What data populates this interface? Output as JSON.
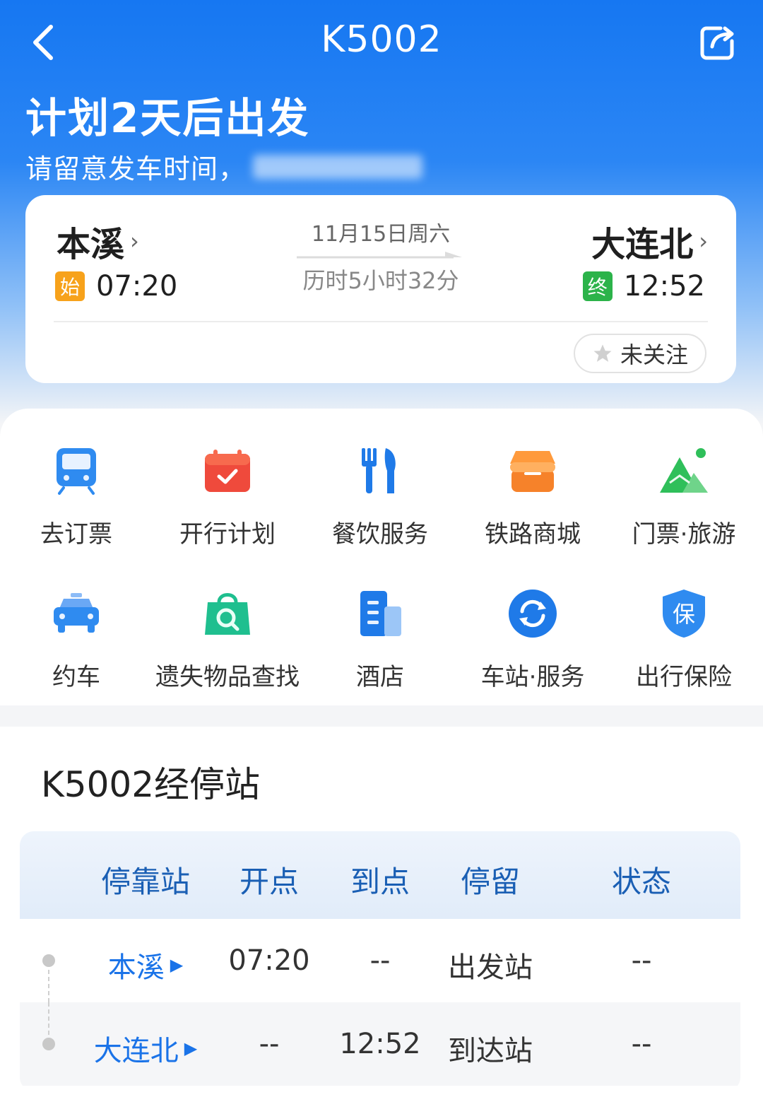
{
  "header": {
    "title": "K5002",
    "plan_title": "计划2天后出发",
    "plan_subtitle": "请留意发车时间，"
  },
  "trip": {
    "from_station": "本溪",
    "to_station": "大连北",
    "from_badge": "始",
    "to_badge": "终",
    "depart_time": "07:20",
    "arrive_time": "12:52",
    "date": "11月15日周六",
    "duration": "历时5小时32分",
    "follow_label": "未关注",
    "chevron": "›"
  },
  "services": [
    {
      "label": "去订票",
      "icon": "train-icon"
    },
    {
      "label": "开行计划",
      "icon": "calendar-icon"
    },
    {
      "label": "餐饮服务",
      "icon": "dining-icon"
    },
    {
      "label": "铁路商城",
      "icon": "store-icon"
    },
    {
      "label": "门票·旅游",
      "icon": "mountain-icon"
    },
    {
      "label": "约车",
      "icon": "car-icon"
    },
    {
      "label": "遗失物品查找",
      "icon": "lost-found-icon"
    },
    {
      "label": "酒店",
      "icon": "hotel-icon"
    },
    {
      "label": "车站·服务",
      "icon": "station-service-icon"
    },
    {
      "label": "出行保险",
      "icon": "insurance-icon"
    }
  ],
  "stops": {
    "title": "K5002经停站",
    "headers": [
      "停靠站",
      "开点",
      "到点",
      "停留",
      "状态"
    ],
    "rows": [
      {
        "station": "本溪",
        "depart": "07:20",
        "arrive": "--",
        "stay": "出发站",
        "status": "--"
      },
      {
        "station": "大连北",
        "depart": "--",
        "arrive": "12:52",
        "stay": "到达站",
        "status": "--"
      }
    ]
  },
  "colors": {
    "primary": "#1677f2",
    "link": "#1a73e8",
    "start_badge": "#f7a21b",
    "end_badge": "#2cb34a"
  }
}
